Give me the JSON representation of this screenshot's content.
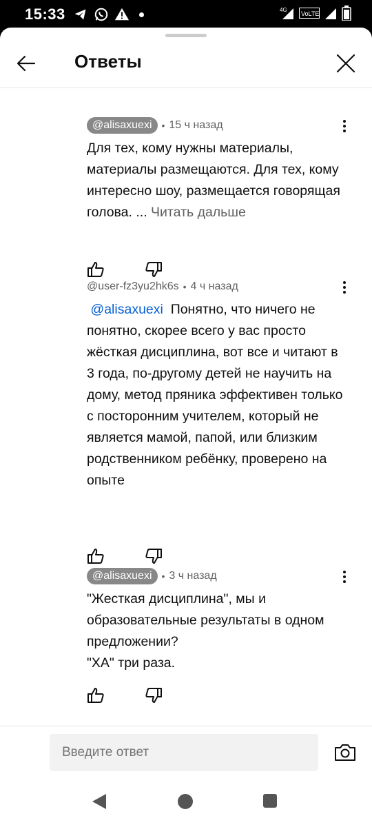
{
  "status_bar": {
    "time": "15:33",
    "left_icons": [
      "telegram-icon",
      "whatsapp-icon",
      "warning-icon",
      "dot-icon"
    ],
    "network_label": "4G",
    "volte_label": "VoLTE"
  },
  "header": {
    "title": "Ответы"
  },
  "comments": [
    {
      "author": "@alisaxuexi",
      "author_style": "chip",
      "separator": "•",
      "time": "15 ч назад",
      "text": "Для тех, кому нужны материалы, материалы размещаются. Для тех, кому интересно шоу, размещается говорящая голова. ...",
      "read_more": "Читать дальше"
    },
    {
      "author": "@user-fz3yu2hk6s",
      "author_style": "plain",
      "separator": "•",
      "time": "4 ч назад",
      "mention": "@alisaxuexi",
      "text": "Понятно, что ничего не понятно, скорее всего у вас просто жёсткая дисциплина, вот все и читают в 3 года, по-другому детей не научить на дому, метод пряника эффективен только с посторонним учителем, который не является мамой, папой, или близким родственником ребёнку, проверено на опыте"
    },
    {
      "author": "@alisaxuexi",
      "author_style": "chip",
      "separator": "•",
      "time": "3 ч назад",
      "text": "\"Жесткая дисциплина\", мы и образовательные результаты в одном предложении?\n\"ХА\" три раза."
    }
  ],
  "reply": {
    "placeholder": "Введите ответ"
  },
  "colors": {
    "mention": "#065fd4",
    "chip_bg": "#888888",
    "secondary_text": "#606060"
  }
}
